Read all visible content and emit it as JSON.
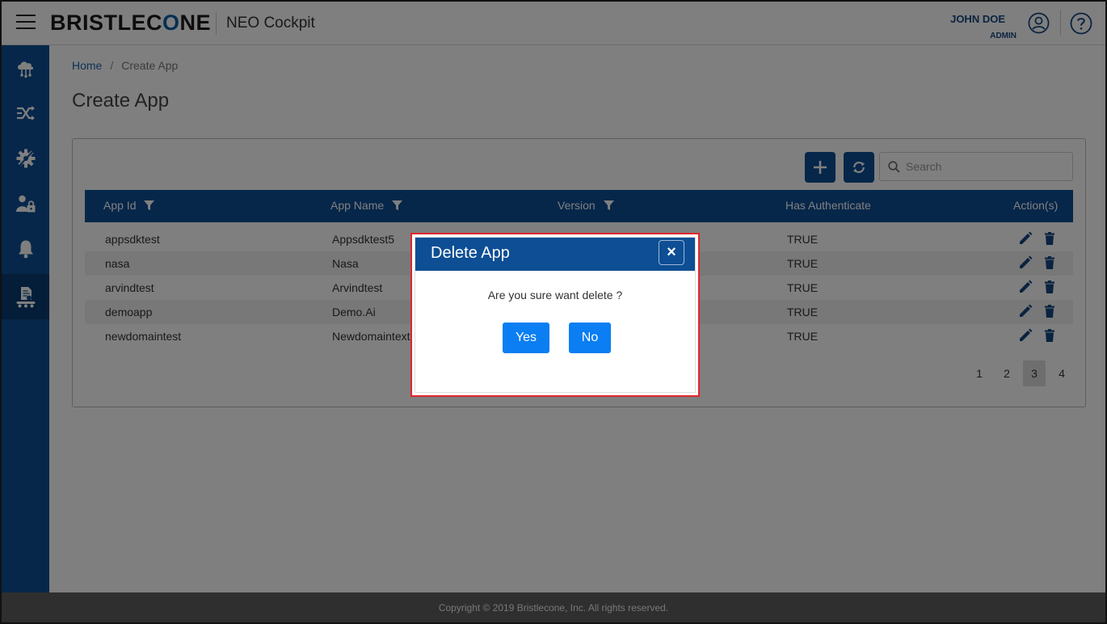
{
  "header": {
    "logo_text_a": "BRISTLEC",
    "logo_text_o": "O",
    "logo_text_b": "NE",
    "product": "NEO Cockpit",
    "user_name": "JOHN DOE",
    "user_role": "ADMIN"
  },
  "sidebar": {
    "items": [
      {
        "icon": "cloud-network-icon"
      },
      {
        "icon": "shuffle-icon"
      },
      {
        "icon": "gear-icon"
      },
      {
        "icon": "user-lock-icon"
      },
      {
        "icon": "bell-icon"
      },
      {
        "icon": "app-conveyor-icon",
        "active": true
      }
    ]
  },
  "breadcrumb": {
    "home": "Home",
    "separator": "/",
    "current": "Create App"
  },
  "page": {
    "title": "Create App"
  },
  "toolbar": {
    "search_placeholder": "Search"
  },
  "table": {
    "columns": [
      "App Id",
      "App Name",
      "Version",
      "Has Authenticate",
      "Action(s)"
    ],
    "rows": [
      {
        "app_id": "appsdktest",
        "app_name": "Appsdktest5",
        "has_auth": "TRUE"
      },
      {
        "app_id": "nasa",
        "app_name": "Nasa",
        "has_auth": "TRUE"
      },
      {
        "app_id": "arvindtest",
        "app_name": "Arvindtest",
        "has_auth": "TRUE"
      },
      {
        "app_id": "demoapp",
        "app_name": "Demo.Ai",
        "has_auth": "TRUE"
      },
      {
        "app_id": "newdomaintest",
        "app_name": "Newdomaintext",
        "has_auth": "TRUE"
      }
    ]
  },
  "pagination": {
    "pages": [
      "1",
      "2",
      "3",
      "4"
    ],
    "current": "3"
  },
  "footer": {
    "copyright": "Copyright © 2019 Bristlecone, Inc. All rights reserved."
  },
  "modal": {
    "title": "Delete App",
    "close": "×",
    "message": "Are you sure want delete ?",
    "yes": "Yes",
    "no": "No"
  },
  "colors": {
    "primary": "#0d4e94",
    "button": "#0a7ef2",
    "highlight": "#e1262c"
  }
}
